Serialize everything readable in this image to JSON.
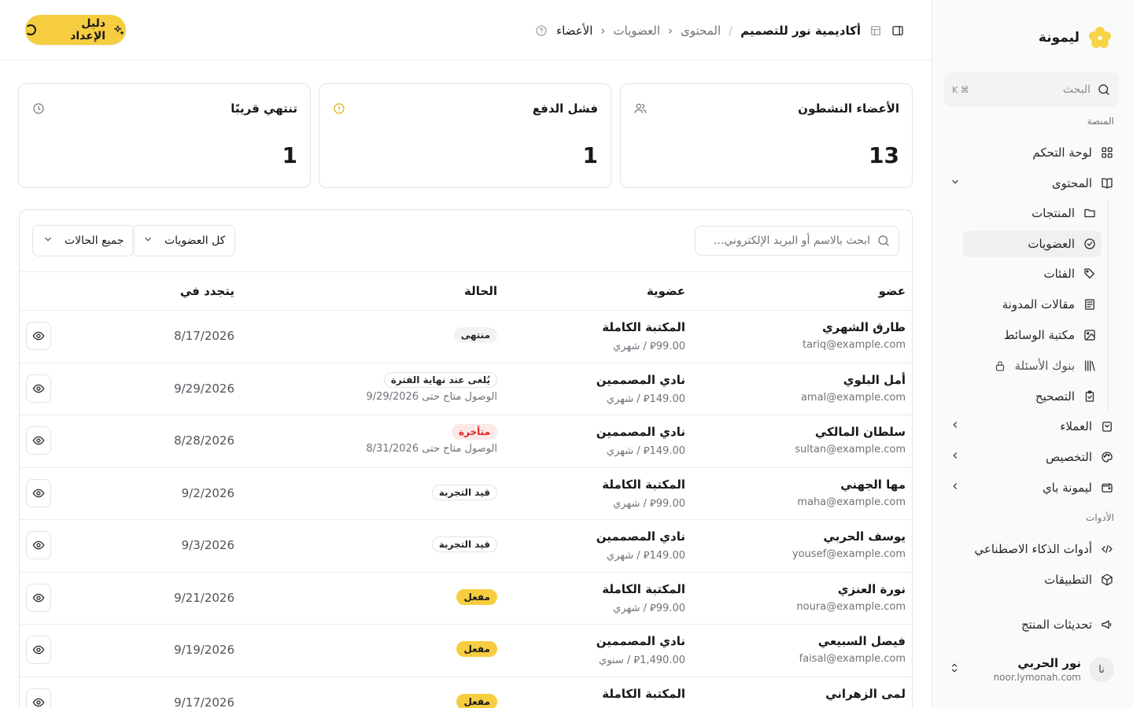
{
  "brand": {
    "name": "ليمونة",
    "accent": "#f6cd3f"
  },
  "sidebar": {
    "search_placeholder": "البحث",
    "search_shortcut": "⌘ K",
    "section_platform": "المنصة",
    "section_tools": "الأدوات",
    "items": [
      {
        "label": "لوحة التحكم",
        "icon": "grid-icon"
      },
      {
        "label": "المحتوى",
        "icon": "book-icon"
      },
      {
        "label": "العملاء",
        "icon": "users-icon"
      },
      {
        "label": "التخصيص",
        "icon": "palette-icon"
      },
      {
        "label": "ليمونة باي",
        "icon": "wallet-icon"
      },
      {
        "label": "أدوات الذكاء الاصطناعي",
        "icon": "code-icon"
      },
      {
        "label": "التطبيقات",
        "icon": "box-icon"
      },
      {
        "label": "تحديثات المنتج",
        "icon": "megaphone-icon"
      }
    ],
    "content_sub": [
      {
        "label": "المنتجات",
        "icon": "folder-icon"
      },
      {
        "label": "العضويات",
        "icon": "check-circle-icon"
      },
      {
        "label": "الفئات",
        "icon": "tags-icon"
      },
      {
        "label": "مقالات المدونة",
        "icon": "newspaper-icon"
      },
      {
        "label": "مكتبة الوسائط",
        "icon": "image-icon"
      },
      {
        "label": "بنوك الأسئلة",
        "icon": "library-icon"
      },
      {
        "label": "التصحيح",
        "icon": "clipboard-check-icon"
      }
    ],
    "user": {
      "initials": "نا",
      "name": "نور الحربي",
      "email": "noor.lymonah.com"
    }
  },
  "header": {
    "breadcrumb": [
      "أكاديمية نور للتصميم",
      "المحتوى",
      "العضويات",
      "الأعضاء"
    ],
    "setup_label": "دليل الإعداد"
  },
  "stats": [
    {
      "title": "الأعضاء النشطون",
      "value": "13",
      "icon": "users-icon",
      "color": "#71717a"
    },
    {
      "title": "فشل الدفع",
      "value": "1",
      "icon": "alert-circle-icon",
      "color": "#e0a800"
    },
    {
      "title": "تنتهي قريبًا",
      "value": "1",
      "icon": "clock-icon",
      "color": "#71717a"
    }
  ],
  "filters": {
    "search_placeholder": "ابحث بالاسم أو البريد الإلكتروني...",
    "membership": "كل العضويات",
    "status": "جميع الحالات"
  },
  "table": {
    "columns": {
      "member": "عضو",
      "membership": "عضوية",
      "status": "الحالة",
      "renews": "يتجدد في"
    },
    "rows": [
      {
        "name": "طارق الشهري",
        "email": "tariq@example.com",
        "plan": "المكتبة الكاملة",
        "price": "⃁99.00 / شهري",
        "status": "منتهى",
        "status_type": "ended",
        "note": "",
        "renews": "8/17/2026"
      },
      {
        "name": "أمل البلوي",
        "email": "amal@example.com",
        "plan": "نادي المصممين",
        "price": "⃁149.00 / شهري",
        "status": "يُلغى عند نهاية الفترة",
        "status_type": "outline",
        "note": "الوصول متاح حتى 9/29/2026",
        "renews": "9/29/2026"
      },
      {
        "name": "سلطان المالكي",
        "email": "sultan@example.com",
        "plan": "نادي المصممين",
        "price": "⃁149.00 / شهري",
        "status": "متأخرة",
        "status_type": "late",
        "note": "الوصول متاح حتى 8/31/2026",
        "renews": "8/28/2026"
      },
      {
        "name": "مها الجهني",
        "email": "maha@example.com",
        "plan": "المكتبة الكاملة",
        "price": "⃁99.00 / شهري",
        "status": "قيد التجربة",
        "status_type": "outline",
        "note": "",
        "renews": "9/2/2026"
      },
      {
        "name": "يوسف الحربي",
        "email": "yousef@example.com",
        "plan": "نادي المصممين",
        "price": "⃁149.00 / شهري",
        "status": "قيد التجربة",
        "status_type": "outline",
        "note": "",
        "renews": "9/3/2026"
      },
      {
        "name": "نورة العنزي",
        "email": "noura@example.com",
        "plan": "المكتبة الكاملة",
        "price": "⃁99.00 / شهري",
        "status": "مفعل",
        "status_type": "active",
        "note": "",
        "renews": "9/21/2026"
      },
      {
        "name": "فيصل السبيعي",
        "email": "faisal@example.com",
        "plan": "نادي المصممين",
        "price": "⃁1,490.00 / سنوي",
        "status": "مفعل",
        "status_type": "active",
        "note": "",
        "renews": "9/19/2026"
      },
      {
        "name": "لمى الزهراني",
        "email": "",
        "plan": "المكتبة الكاملة",
        "price": "",
        "status": "مفعل",
        "status_type": "active",
        "note": "",
        "renews": "9/17/2026"
      }
    ]
  }
}
